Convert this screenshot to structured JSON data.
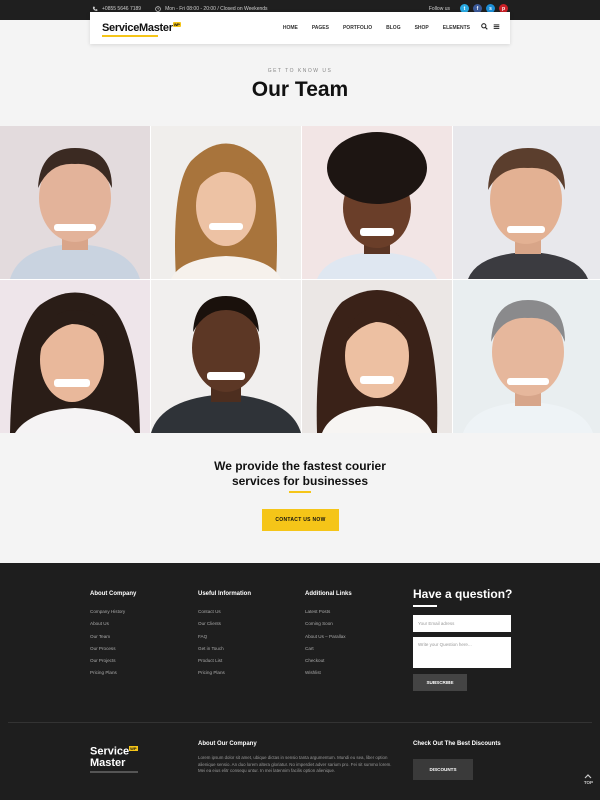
{
  "topbar": {
    "phone": "+0855 5646 7189",
    "hours": "Mon - Fri 08:00 - 20:00 / Closed on Weekends",
    "follow_label": "Follow us",
    "social_icons": [
      "twitter-icon",
      "facebook-icon",
      "skype-icon",
      "pinterest-icon"
    ]
  },
  "header": {
    "logo_text": "ServiceMaster",
    "logo_badge": "WP",
    "nav": [
      "HOME",
      "PAGES",
      "PORTFOLIO",
      "BLOG",
      "SHOP",
      "ELEMENTS"
    ]
  },
  "hero": {
    "eyebrow": "GET TO KNOW US",
    "title": "Our Team"
  },
  "team": {
    "photos": [
      {
        "bg": "#e4dcde"
      },
      {
        "bg": "#f1efed"
      },
      {
        "bg": "#f2e6e6"
      },
      {
        "bg": "#e8e8ec"
      },
      {
        "bg": "#efe6ec"
      },
      {
        "bg": "#f1efee"
      },
      {
        "bg": "#ebe7e5"
      },
      {
        "bg": "#e9eef0"
      }
    ]
  },
  "cta": {
    "line1": "We provide the fastest courier",
    "line2": "services for businesses",
    "button": "CONTACT US NOW"
  },
  "footer": {
    "col1": {
      "title": "About Company",
      "items": [
        "Company History",
        "About Us",
        "Our Team",
        "Our Process",
        "Our Projects",
        "Pricing Plans"
      ]
    },
    "col2": {
      "title": "Useful Information",
      "items": [
        "Contact Us",
        "Our Clients",
        "FAQ",
        "Get in Touch",
        "Product List",
        "Pricing Plans"
      ]
    },
    "col3": {
      "title": "Additional Links",
      "items": [
        "Latest Posts",
        "Coming Soon",
        "About Us – Parallax",
        "Cart",
        "Checkout",
        "Wishlist"
      ]
    },
    "question": {
      "title": "Have a question?",
      "email_placeholder": "Your Email adress",
      "question_placeholder": "Write your Question here...",
      "button": "SUBSCRIBE"
    },
    "logo_line1": "Service",
    "logo_line2": "Master",
    "logo_badge": "WP",
    "about_title": "About Our Company",
    "about_text": "Lorem ipsum dolor sit amet, ubique dictas in sensio tanta argumentum. Mundi eu sea, liber option alienique sensio. An duo lorem altera gloriatur. No imperdiet adver sarium pro. Fei sit summo lorem. Mei ea eius elitr consequ untur. In mei latennim facilis option alienique.",
    "discount_title": "Check Out The Best Discounts",
    "discount_button": "DISCOUNTS",
    "top_label": "TOP"
  }
}
